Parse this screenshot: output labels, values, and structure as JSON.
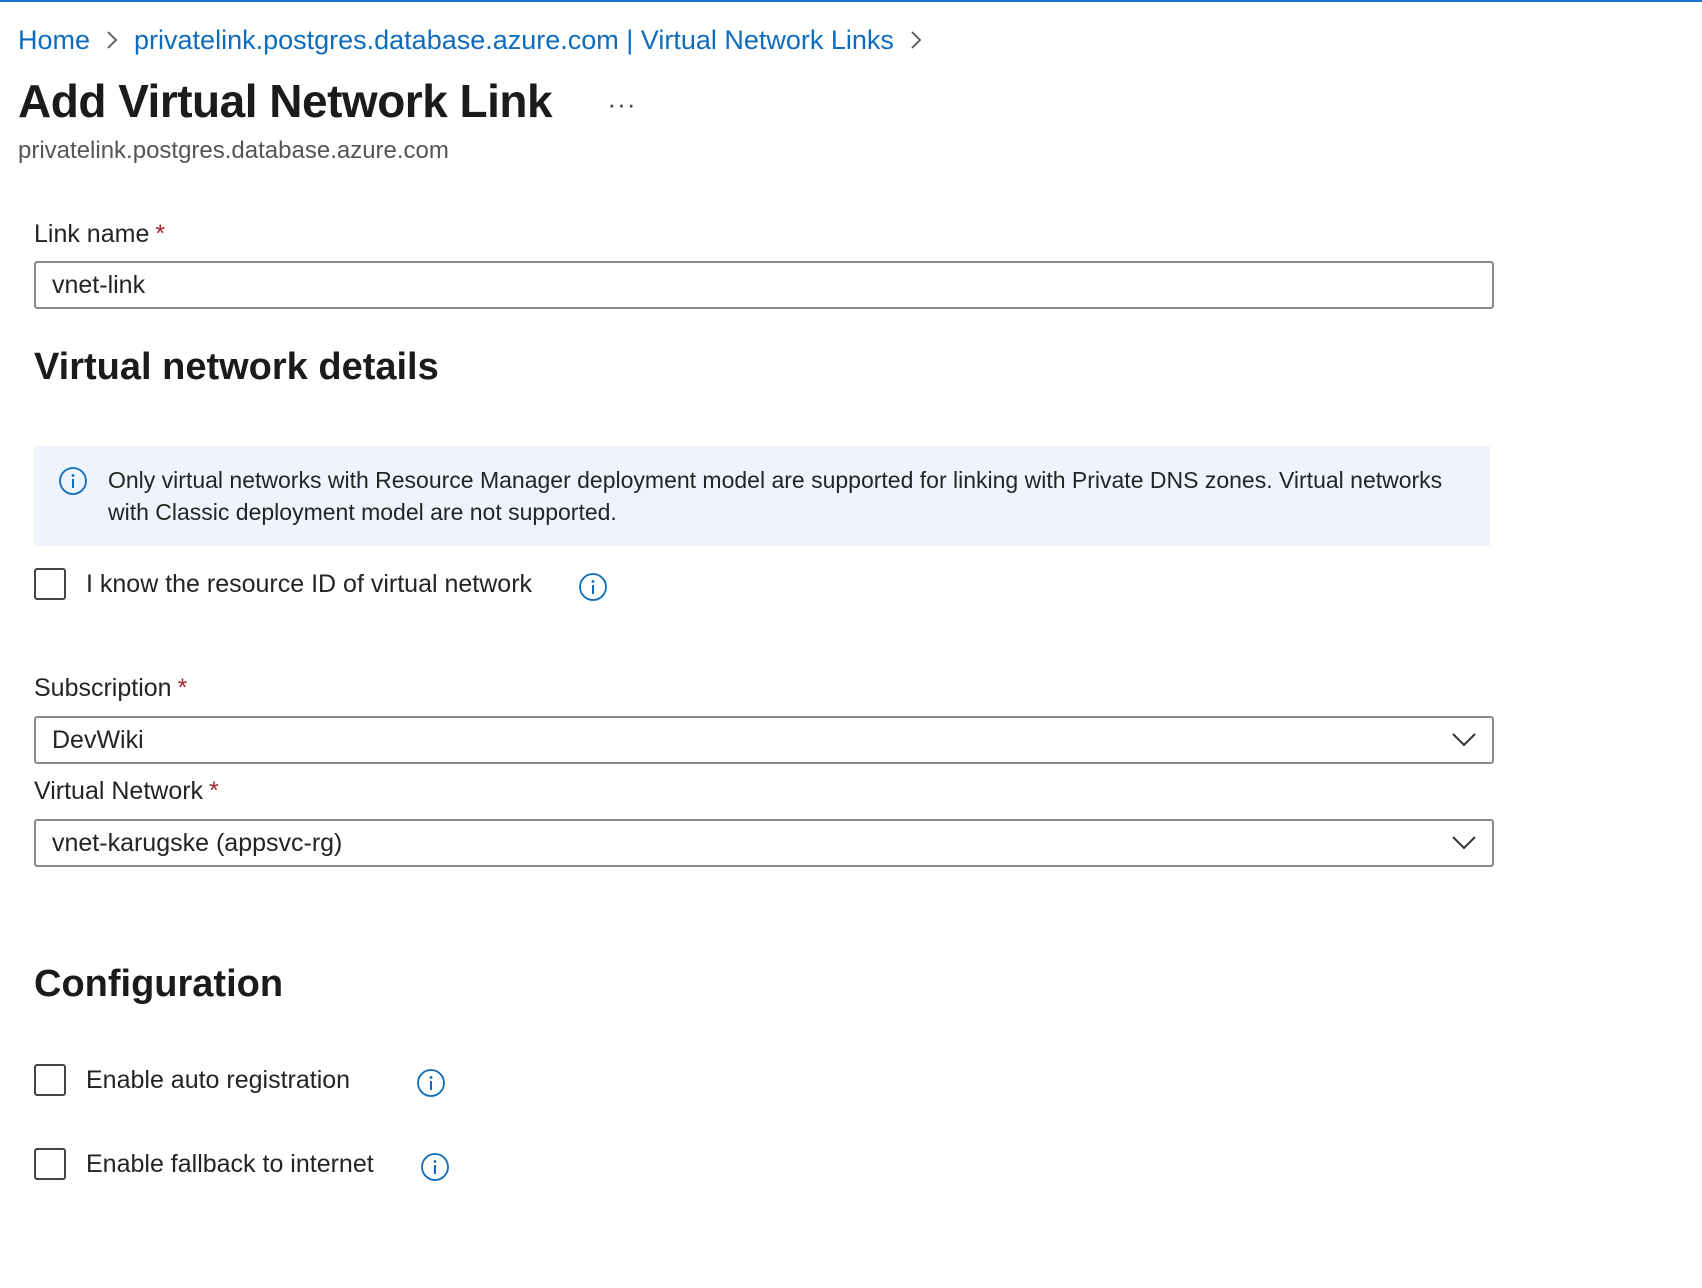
{
  "breadcrumb": {
    "items": [
      {
        "label": "Home"
      },
      {
        "label": "privatelink.postgres.database.azure.com | Virtual Network Links"
      }
    ]
  },
  "header": {
    "title": "Add Virtual Network Link",
    "more_label": "···",
    "subtitle": "privatelink.postgres.database.azure.com"
  },
  "form": {
    "link_name": {
      "label": "Link name",
      "required_marker": "*",
      "value": "vnet-link"
    },
    "vnet_section": {
      "heading": "Virtual network details",
      "info_banner": "Only virtual networks with Resource Manager deployment model are supported for linking with Private DNS zones. Virtual networks with Classic deployment model are not supported.",
      "resource_id_checkbox": {
        "label": "I know the resource ID of virtual network",
        "checked": false
      },
      "subscription": {
        "label": "Subscription",
        "required_marker": "*",
        "value": "DevWiki"
      },
      "virtual_network": {
        "label": "Virtual Network",
        "required_marker": "*",
        "value": "vnet-karugske (appsvc-rg)"
      }
    },
    "configuration": {
      "heading": "Configuration",
      "auto_registration": {
        "label": "Enable auto registration",
        "checked": false
      },
      "fallback_internet": {
        "label": "Enable fallback to internet",
        "checked": false
      }
    }
  },
  "colors": {
    "link": "#0f6cbd",
    "required": "#a4262c",
    "banner_bg": "#eff4fc",
    "info_icon": "#0f6cbd"
  }
}
